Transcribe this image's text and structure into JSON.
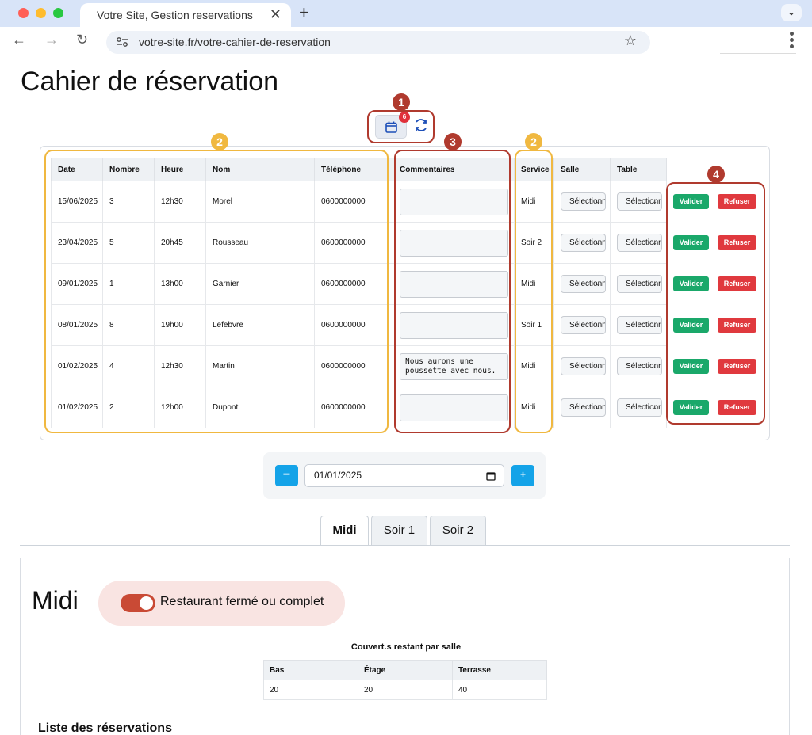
{
  "browser": {
    "tab_title": "Votre Site, Gestion reservations",
    "url": "votre-site.fr/votre-cahier-de-reservation"
  },
  "page": {
    "title": "Cahier de réservation",
    "notification_count": "6"
  },
  "annotations": [
    "1",
    "2",
    "3",
    "2",
    "4"
  ],
  "table": {
    "headers": [
      "Date",
      "Nombre",
      "Heure",
      "Nom",
      "Téléphone",
      "Commentaires",
      "Service",
      "Salle",
      "Table"
    ],
    "select_placeholder": "Sélectionner",
    "valider_label": "Valider",
    "refuser_label": "Refuser",
    "rows": [
      {
        "date": "15/06/2025",
        "nombre": "3",
        "heure": "12h30",
        "nom": "Morel",
        "telephone": "0600000000",
        "commentaire": "",
        "service": "Midi"
      },
      {
        "date": "23/04/2025",
        "nombre": "5",
        "heure": "20h45",
        "nom": "Rousseau",
        "telephone": "0600000000",
        "commentaire": "",
        "service": "Soir 2"
      },
      {
        "date": "09/01/2025",
        "nombre": "1",
        "heure": "13h00",
        "nom": "Garnier",
        "telephone": "0600000000",
        "commentaire": "",
        "service": "Midi"
      },
      {
        "date": "08/01/2025",
        "nombre": "8",
        "heure": "19h00",
        "nom": "Lefebvre",
        "telephone": "0600000000",
        "commentaire": "",
        "service": "Soir 1"
      },
      {
        "date": "01/02/2025",
        "nombre": "4",
        "heure": "12h30",
        "nom": "Martin",
        "telephone": "0600000000",
        "commentaire": "Nous aurons une poussette avec nous.",
        "service": "Midi"
      },
      {
        "date": "01/02/2025",
        "nombre": "2",
        "heure": "12h00",
        "nom": "Dupont",
        "telephone": "0600000000",
        "commentaire": "",
        "service": "Midi"
      }
    ]
  },
  "date_control": {
    "minus_label": "−",
    "plus_label": "+",
    "date_value": "01/01/2025"
  },
  "service_tabs": [
    "Midi",
    "Soir 1",
    "Soir 2"
  ],
  "active_tab": "Midi",
  "panel": {
    "title": "Midi",
    "toggle_label": "Restaurant fermé ou complet",
    "toggle_on": true,
    "capacity_title": "Couvert.s restant par salle",
    "capacity_headers": [
      "Bas",
      "Étage",
      "Terrasse"
    ],
    "capacity_values": [
      "20",
      "20",
      "40"
    ],
    "list_title": "Liste des réservations"
  },
  "colors": {
    "accent_blue": "#14a3e8",
    "valider_green": "#1aa86a",
    "refuser_red": "#e0393e",
    "annotation_red": "#b03a2e",
    "annotation_yellow": "#f0b840",
    "toggle_red": "#c94a35"
  }
}
